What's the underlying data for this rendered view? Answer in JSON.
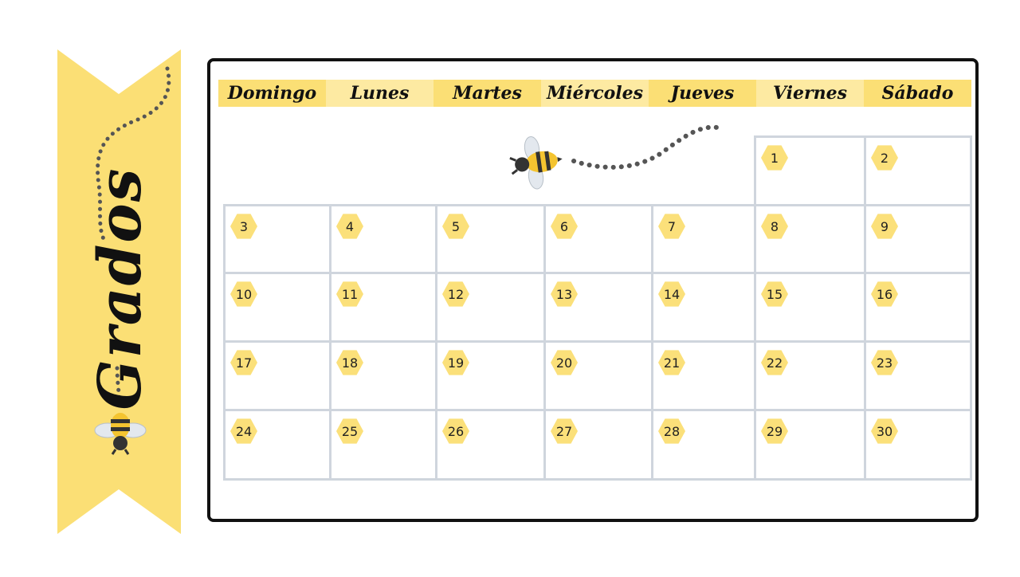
{
  "sidebar": {
    "title": "Grados"
  },
  "calendar": {
    "day_headers": [
      "Domingo",
      "Lunes",
      "Martes",
      "Miércoles",
      "Jueves",
      "Viernes",
      "Sábado"
    ],
    "days": [
      "1",
      "2",
      "3",
      "4",
      "5",
      "6",
      "7",
      "8",
      "9",
      "10",
      "11",
      "12",
      "13",
      "14",
      "15",
      "16",
      "17",
      "18",
      "19",
      "20",
      "21",
      "22",
      "23",
      "24",
      "25",
      "26",
      "27",
      "28",
      "29",
      "30"
    ]
  },
  "colors": {
    "banner": "#fbdf75",
    "header_dark": "#fbdf75",
    "header_light": "#fdeaa2",
    "hexagon": "#fbe07a",
    "grid_line": "#cfd5dd",
    "frame": "#111111"
  },
  "icons": [
    "bee-icon",
    "bee-icon"
  ]
}
